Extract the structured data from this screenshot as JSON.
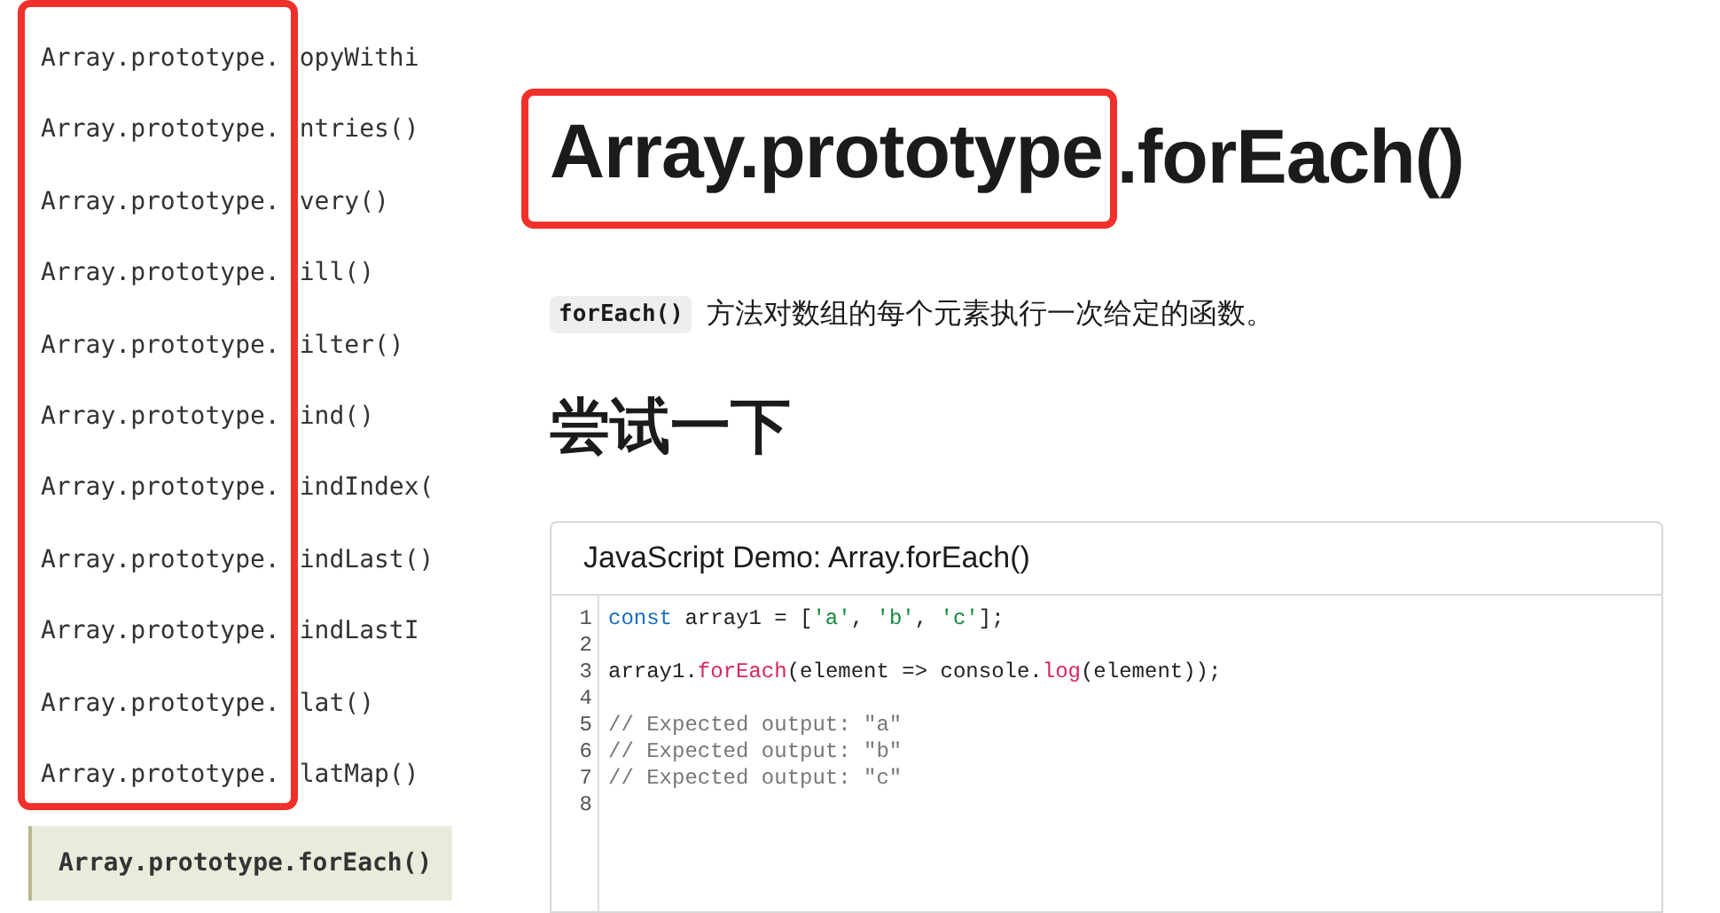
{
  "sidebar": {
    "items": [
      {
        "prefix": "Array.prototype.",
        "name": "opyWithi",
        "selected": false
      },
      {
        "prefix": "Array.prototype.",
        "name": "ntries()",
        "selected": false
      },
      {
        "prefix": "Array.prototype.",
        "name": "very()",
        "selected": false
      },
      {
        "prefix": "Array.prototype.",
        "name": "ill()",
        "selected": false
      },
      {
        "prefix": "Array.prototype.",
        "name": "ilter()",
        "selected": false
      },
      {
        "prefix": "Array.prototype.",
        "name": "ind()",
        "selected": false
      },
      {
        "prefix": "Array.prototype.",
        "name": "indIndex(",
        "selected": false
      },
      {
        "prefix": "Array.prototype.",
        "name": "indLast()",
        "selected": false
      },
      {
        "prefix": "Array.prototype.",
        "name": "indLastI",
        "selected": false
      },
      {
        "prefix": "Array.prototype.",
        "name": "lat()",
        "selected": false
      },
      {
        "prefix": "Array.prototype.",
        "name": "latMap()",
        "selected": false
      },
      {
        "label": "Array.prototype.forEach()",
        "selected": true
      }
    ]
  },
  "title": {
    "highlighted": "Array.prototype",
    "rest": ".forEach()"
  },
  "description": {
    "code": "forEach()",
    "text": "方法对数组的每个元素执行一次给定的函数。"
  },
  "section_heading": "尝试一下",
  "demo": {
    "title": "JavaScript Demo: Array.forEach()",
    "lines": [
      {
        "number": "1",
        "tokens": [
          {
            "kind": "keyword",
            "text": "const"
          },
          {
            "kind": "plain",
            "text": " array1 = ["
          },
          {
            "kind": "string",
            "text": "'a'"
          },
          {
            "kind": "plain",
            "text": ", "
          },
          {
            "kind": "string",
            "text": "'b'"
          },
          {
            "kind": "plain",
            "text": ", "
          },
          {
            "kind": "string",
            "text": "'c'"
          },
          {
            "kind": "plain",
            "text": "];"
          }
        ]
      },
      {
        "number": "2"
      },
      {
        "number": "3",
        "tokens": [
          {
            "kind": "plain",
            "text": "array1."
          },
          {
            "kind": "function",
            "text": "forEach"
          },
          {
            "kind": "plain",
            "text": "(element => console."
          },
          {
            "kind": "function",
            "text": "log"
          },
          {
            "kind": "plain",
            "text": "(element));"
          }
        ]
      },
      {
        "number": "4"
      },
      {
        "number": "5",
        "tokens": [
          {
            "kind": "comment",
            "text": "// Expected output: \"a\""
          }
        ]
      },
      {
        "number": "6",
        "tokens": [
          {
            "kind": "comment",
            "text": "// Expected output: \"b\""
          }
        ]
      },
      {
        "number": "7",
        "tokens": [
          {
            "kind": "comment",
            "text": "// Expected output: \"c\""
          }
        ]
      },
      {
        "number": "8"
      }
    ]
  }
}
